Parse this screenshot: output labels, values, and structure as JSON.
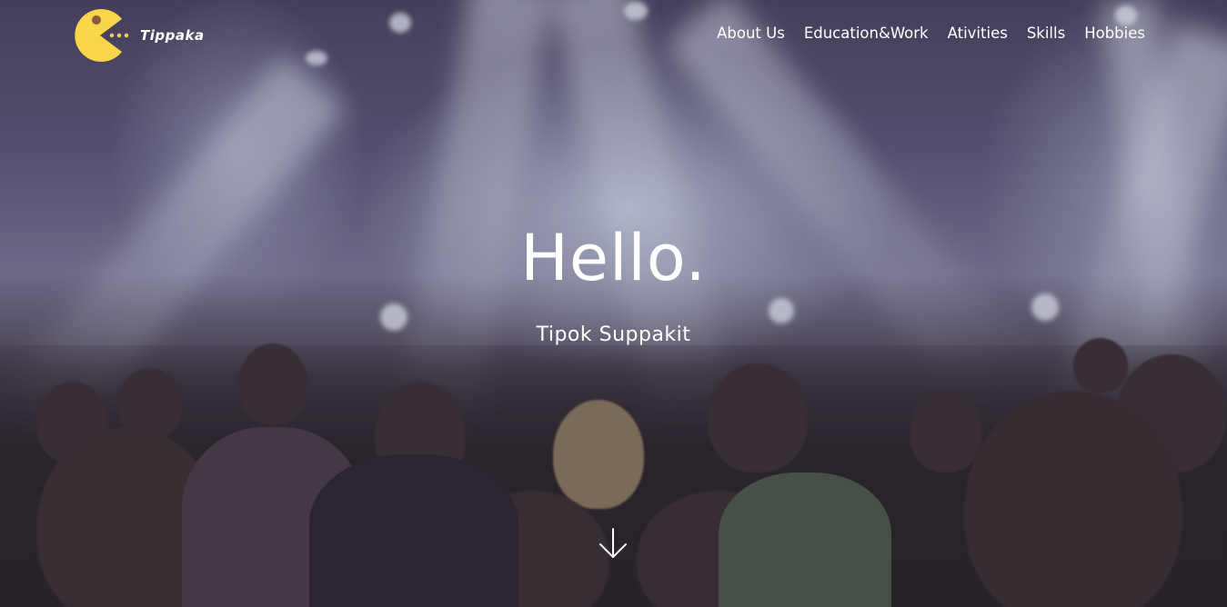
{
  "header": {
    "logo_text": "Tippaka",
    "logo_icon": "pacman-icon",
    "logo_colors": {
      "body": "#f9d649",
      "eye": "#8a5a3c",
      "dots": "#f9d649"
    }
  },
  "nav": {
    "items": [
      {
        "label": "About Us"
      },
      {
        "label": "Education&Work"
      },
      {
        "label": "Ativities"
      },
      {
        "label": "Skills"
      },
      {
        "label": "Hobbies"
      }
    ]
  },
  "hero": {
    "title": "Hello.",
    "subtitle": "Tipok Suppakit",
    "background": "concert-crowd-photo",
    "scroll_icon": "arrow-down-icon"
  }
}
